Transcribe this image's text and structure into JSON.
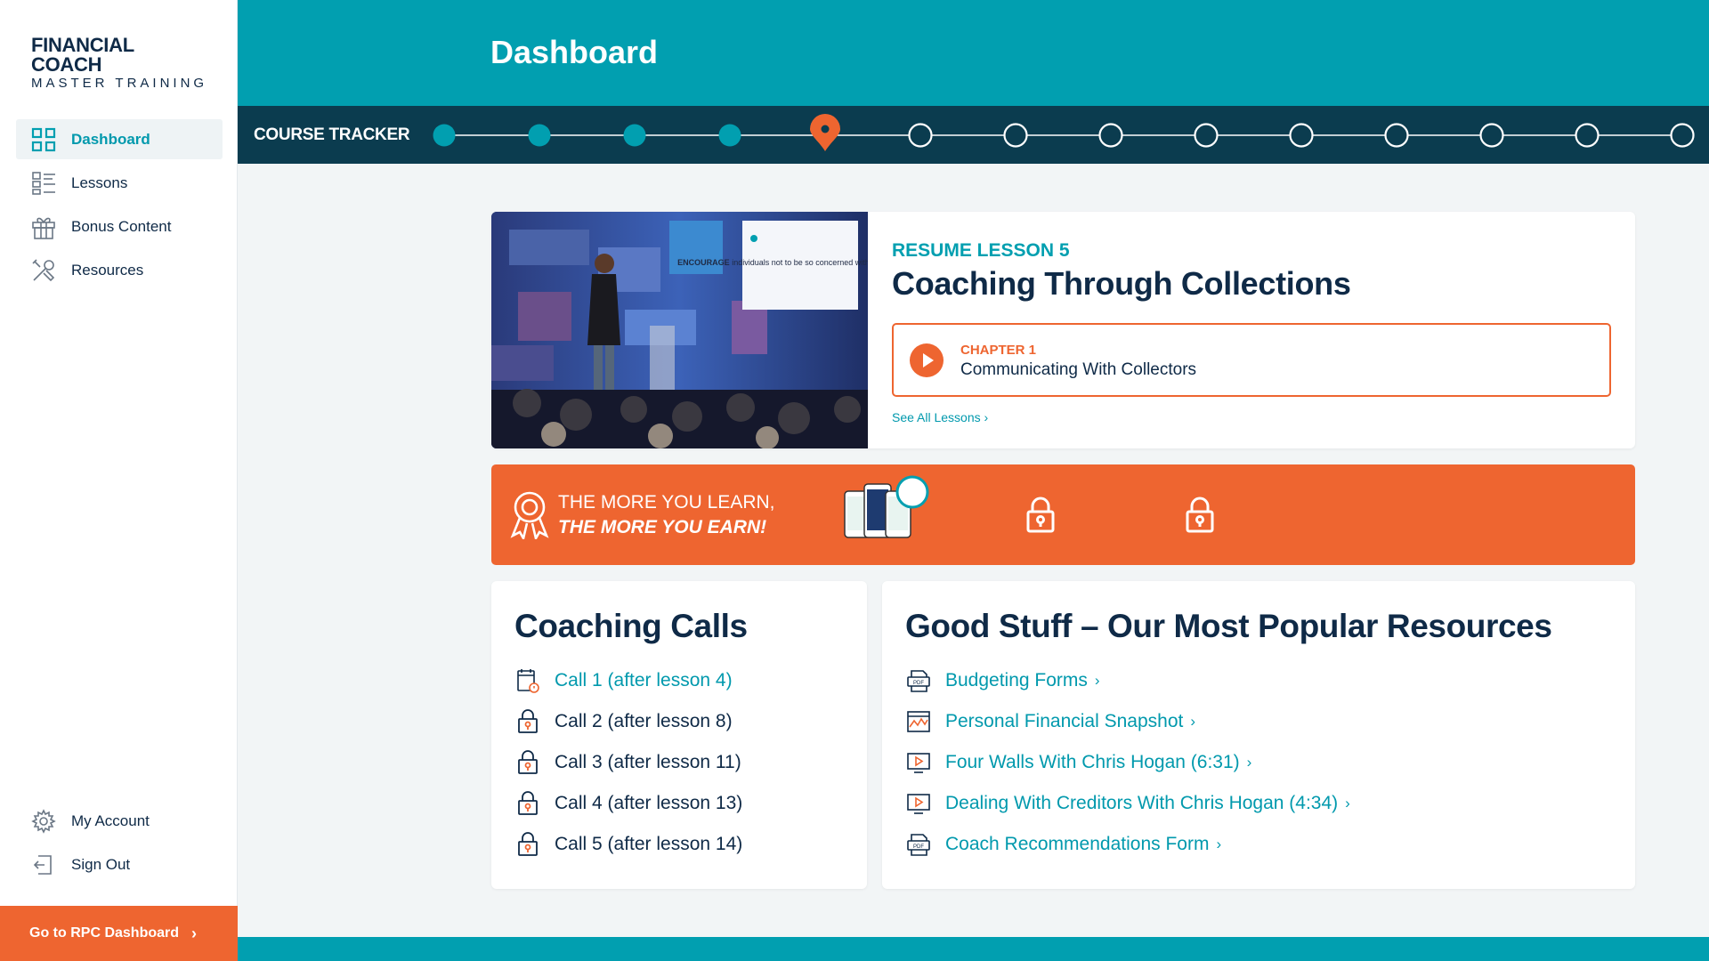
{
  "brand": {
    "line1": "FINANCIAL COACH",
    "line2": "MASTER TRAINING"
  },
  "sidebar": {
    "items": [
      {
        "label": "Dashboard",
        "icon": "grid-icon",
        "active": true
      },
      {
        "label": "Lessons",
        "icon": "list-icon"
      },
      {
        "label": "Bonus Content",
        "icon": "gift-icon"
      },
      {
        "label": "Resources",
        "icon": "tools-icon"
      }
    ],
    "bottom": [
      {
        "label": "My Account",
        "icon": "gear-icon"
      },
      {
        "label": "Sign Out",
        "icon": "sign-out-icon"
      }
    ],
    "rpc_button": "Go to RPC Dashboard"
  },
  "header": {
    "title": "Dashboard"
  },
  "tracker": {
    "label": "COURSE TRACKER",
    "completed": 4,
    "current": 5,
    "total": 14
  },
  "resume": {
    "label": "RESUME LESSON 5",
    "title": "Coaching Through Collections",
    "chapter_label": "CHAPTER 1",
    "chapter_title": "Communicating With Collectors",
    "see_all": "See All Lessons",
    "slide_text_bold": "ENCOURAGE",
    "slide_text": " individuals not to be so concerned with their credit scores."
  },
  "earn": {
    "line1": "THE MORE YOU LEARN,",
    "line2": "THE MORE YOU EARN!"
  },
  "calls": {
    "title": "Coaching Calls",
    "items": [
      {
        "label": "Call 1 (after lesson 4)",
        "status": "unlocked"
      },
      {
        "label": "Call 2 (after lesson 8)",
        "status": "locked"
      },
      {
        "label": "Call 3 (after lesson 11)",
        "status": "locked"
      },
      {
        "label": "Call 4 (after lesson 13)",
        "status": "locked"
      },
      {
        "label": "Call 5 (after lesson 14)",
        "status": "locked"
      }
    ]
  },
  "popular": {
    "title": "Good Stuff – Our Most Popular Resources",
    "items": [
      {
        "label": "Budgeting Forms",
        "icon": "pdf-icon"
      },
      {
        "label": "Personal Financial Snapshot",
        "icon": "chart-icon"
      },
      {
        "label": "Four Walls With Chris Hogan (6:31)",
        "icon": "video-icon"
      },
      {
        "label": "Dealing With Creditors With Chris Hogan (4:34)",
        "icon": "video-icon"
      },
      {
        "label": "Coach Recommendations Form",
        "icon": "pdf-icon"
      }
    ]
  },
  "colors": {
    "teal": "#019fb0",
    "navy": "#0f2a47",
    "orange": "#ee6530",
    "dark_teal": "#0b3c4f"
  }
}
